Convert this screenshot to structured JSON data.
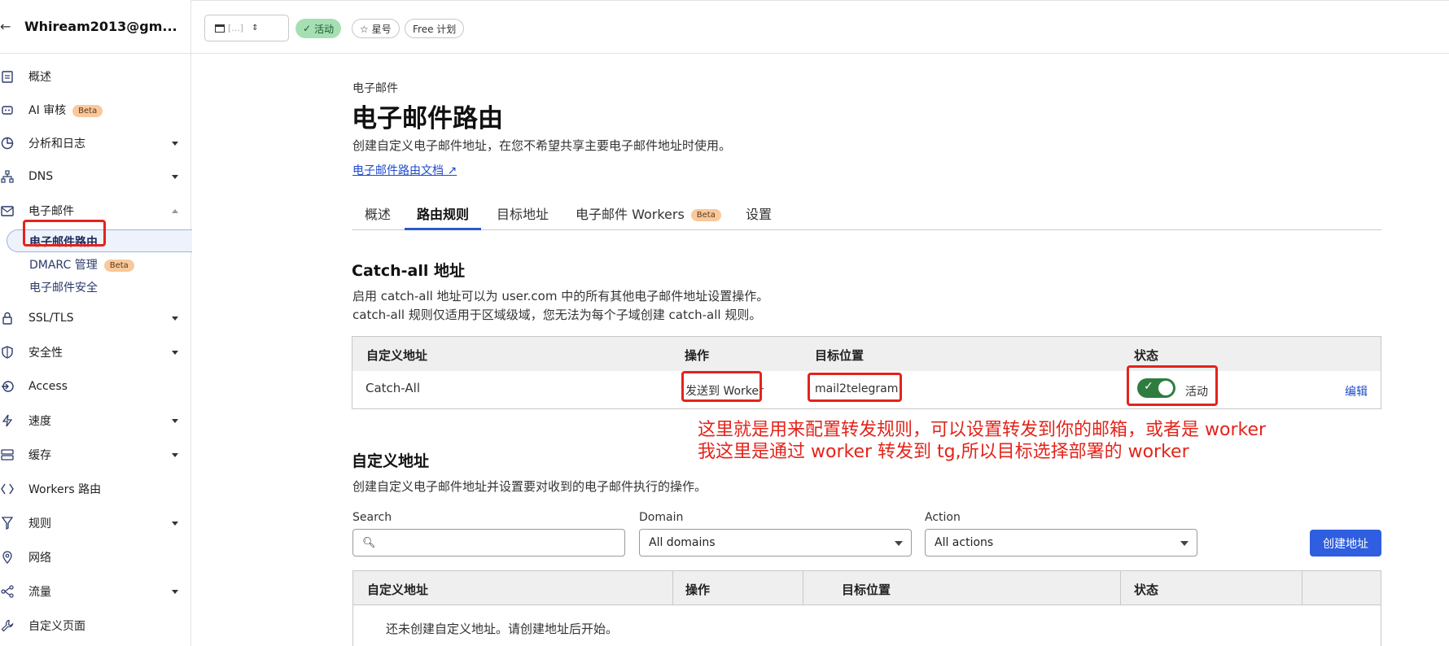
{
  "account": {
    "back_icon": "←",
    "name": "Whiream2013@gm..."
  },
  "sidebar": {
    "items": [
      {
        "label": "概述"
      },
      {
        "label": "AI 审核",
        "badge": "Beta"
      },
      {
        "label": "分析和日志"
      },
      {
        "label": "DNS"
      },
      {
        "label": "电子邮件"
      },
      {
        "label": "SSL/TLS"
      },
      {
        "label": "安全性"
      },
      {
        "label": "Access"
      },
      {
        "label": "速度"
      },
      {
        "label": "缓存"
      },
      {
        "label": "Workers 路由"
      },
      {
        "label": "规则"
      },
      {
        "label": "网络"
      },
      {
        "label": "流量"
      },
      {
        "label": "自定义页面"
      }
    ],
    "email_sub": [
      {
        "label": "电子邮件路由"
      },
      {
        "label": "DMARC 管理",
        "badge": "Beta"
      },
      {
        "label": "电子邮件安全"
      }
    ]
  },
  "topbar": {
    "zone": "[...]",
    "status": "活动",
    "star": "☆ 星号",
    "plan": "Free 计划"
  },
  "page": {
    "breadcrumb": "电子邮件",
    "title": "电子邮件路由",
    "description": "创建自定义电子邮件地址，在您不希望共享主要电子邮件地址时使用。",
    "doc_link": "电子邮件路由文档 ↗"
  },
  "tabs": [
    {
      "label": "概述"
    },
    {
      "label": "路由规则"
    },
    {
      "label": "目标地址"
    },
    {
      "label": "电子邮件 Workers",
      "badge": "Beta"
    },
    {
      "label": "设置"
    }
  ],
  "catchall": {
    "title": "Catch-all 地址",
    "desc1": "启用 catch-all 地址可以为 user.com 中的所有其他电子邮件地址设置操作。",
    "desc2": "catch-all 规则仅适用于区域级域，您无法为每个子域创建 catch-all 规则。",
    "headers": [
      "自定义地址",
      "操作",
      "目标位置",
      "状态"
    ],
    "row": {
      "address": "Catch-All",
      "action": "发送到 Worker",
      "target": "mail2telegram",
      "status": "活动",
      "edit": "编辑"
    }
  },
  "annotation": {
    "line1": "这里就是用来配置转发规则，可以设置转发到你的邮箱，或者是 worker",
    "line2": "我这里是通过 worker 转发到 tg,所以目标选择部署的 worker"
  },
  "custom": {
    "title": "自定义地址",
    "desc": "创建自定义电子邮件地址并设置要对收到的电子邮件执行的操作。",
    "search_label": "Search",
    "search_placeholder": "",
    "domain_label": "Domain",
    "domain_value": "All domains",
    "action_label": "Action",
    "action_value": "All actions",
    "create_button": "创建地址",
    "headers": [
      "自定义地址",
      "操作",
      "目标位置",
      "状态"
    ],
    "empty": "还未创建自定义地址。请创建地址后开始。"
  },
  "colors": {
    "accent": "#2f5fe0",
    "annotation_red": "#e3241b",
    "status_green": "#2e7d3f",
    "beta_badge": "#f9c89b"
  }
}
